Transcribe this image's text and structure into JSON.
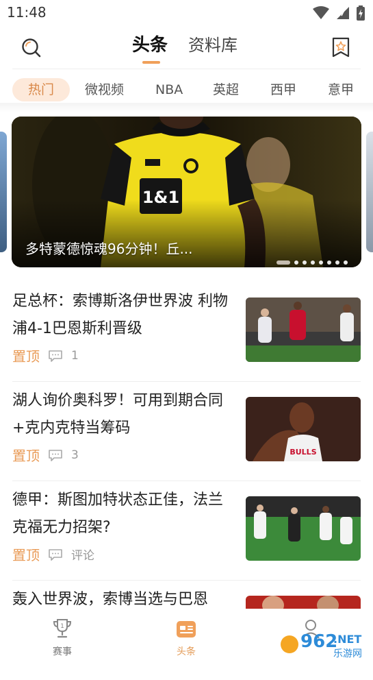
{
  "status": {
    "time": "11:48"
  },
  "header": {
    "tabs": [
      {
        "label": "头条"
      },
      {
        "label": "资料库"
      }
    ],
    "search_icon": "search-icon",
    "bookmark_icon": "bookmark-star-icon",
    "accent": "#f0a05a"
  },
  "categories": [
    {
      "label": "热门"
    },
    {
      "label": "微视频"
    },
    {
      "label": "NBA"
    },
    {
      "label": "英超"
    },
    {
      "label": "西甲"
    },
    {
      "label": "意甲"
    }
  ],
  "banner": {
    "caption": "多特蒙德惊魂96分钟！丘...",
    "slides_count": 8,
    "active_slide": 1
  },
  "news": [
    {
      "title": "足总杯：索博斯洛伊世界波 利物浦4-1巴恩斯利晋级",
      "tag": "置顶",
      "comments": "1"
    },
    {
      "title": "湖人询价奥科罗！可用到期合同+克内克特当筹码",
      "tag": "置顶",
      "comments": "3"
    },
    {
      "title": "德甲：斯图加特状态正佳，法兰克福无力招架?",
      "tag": "置顶",
      "comments": "评论"
    },
    {
      "title": "轰入世界波，索博当选与巴恩",
      "tag": "",
      "comments": ""
    }
  ],
  "bottom_nav": [
    {
      "label": "赛事",
      "icon": "trophy-icon",
      "active": false
    },
    {
      "label": "头条",
      "icon": "news-card-icon",
      "active": true
    },
    {
      "label": "",
      "icon": "profile-icon",
      "active": false
    }
  ],
  "watermark": {
    "text1": "962",
    "text2": ".NET",
    "text3": "乐游网"
  }
}
